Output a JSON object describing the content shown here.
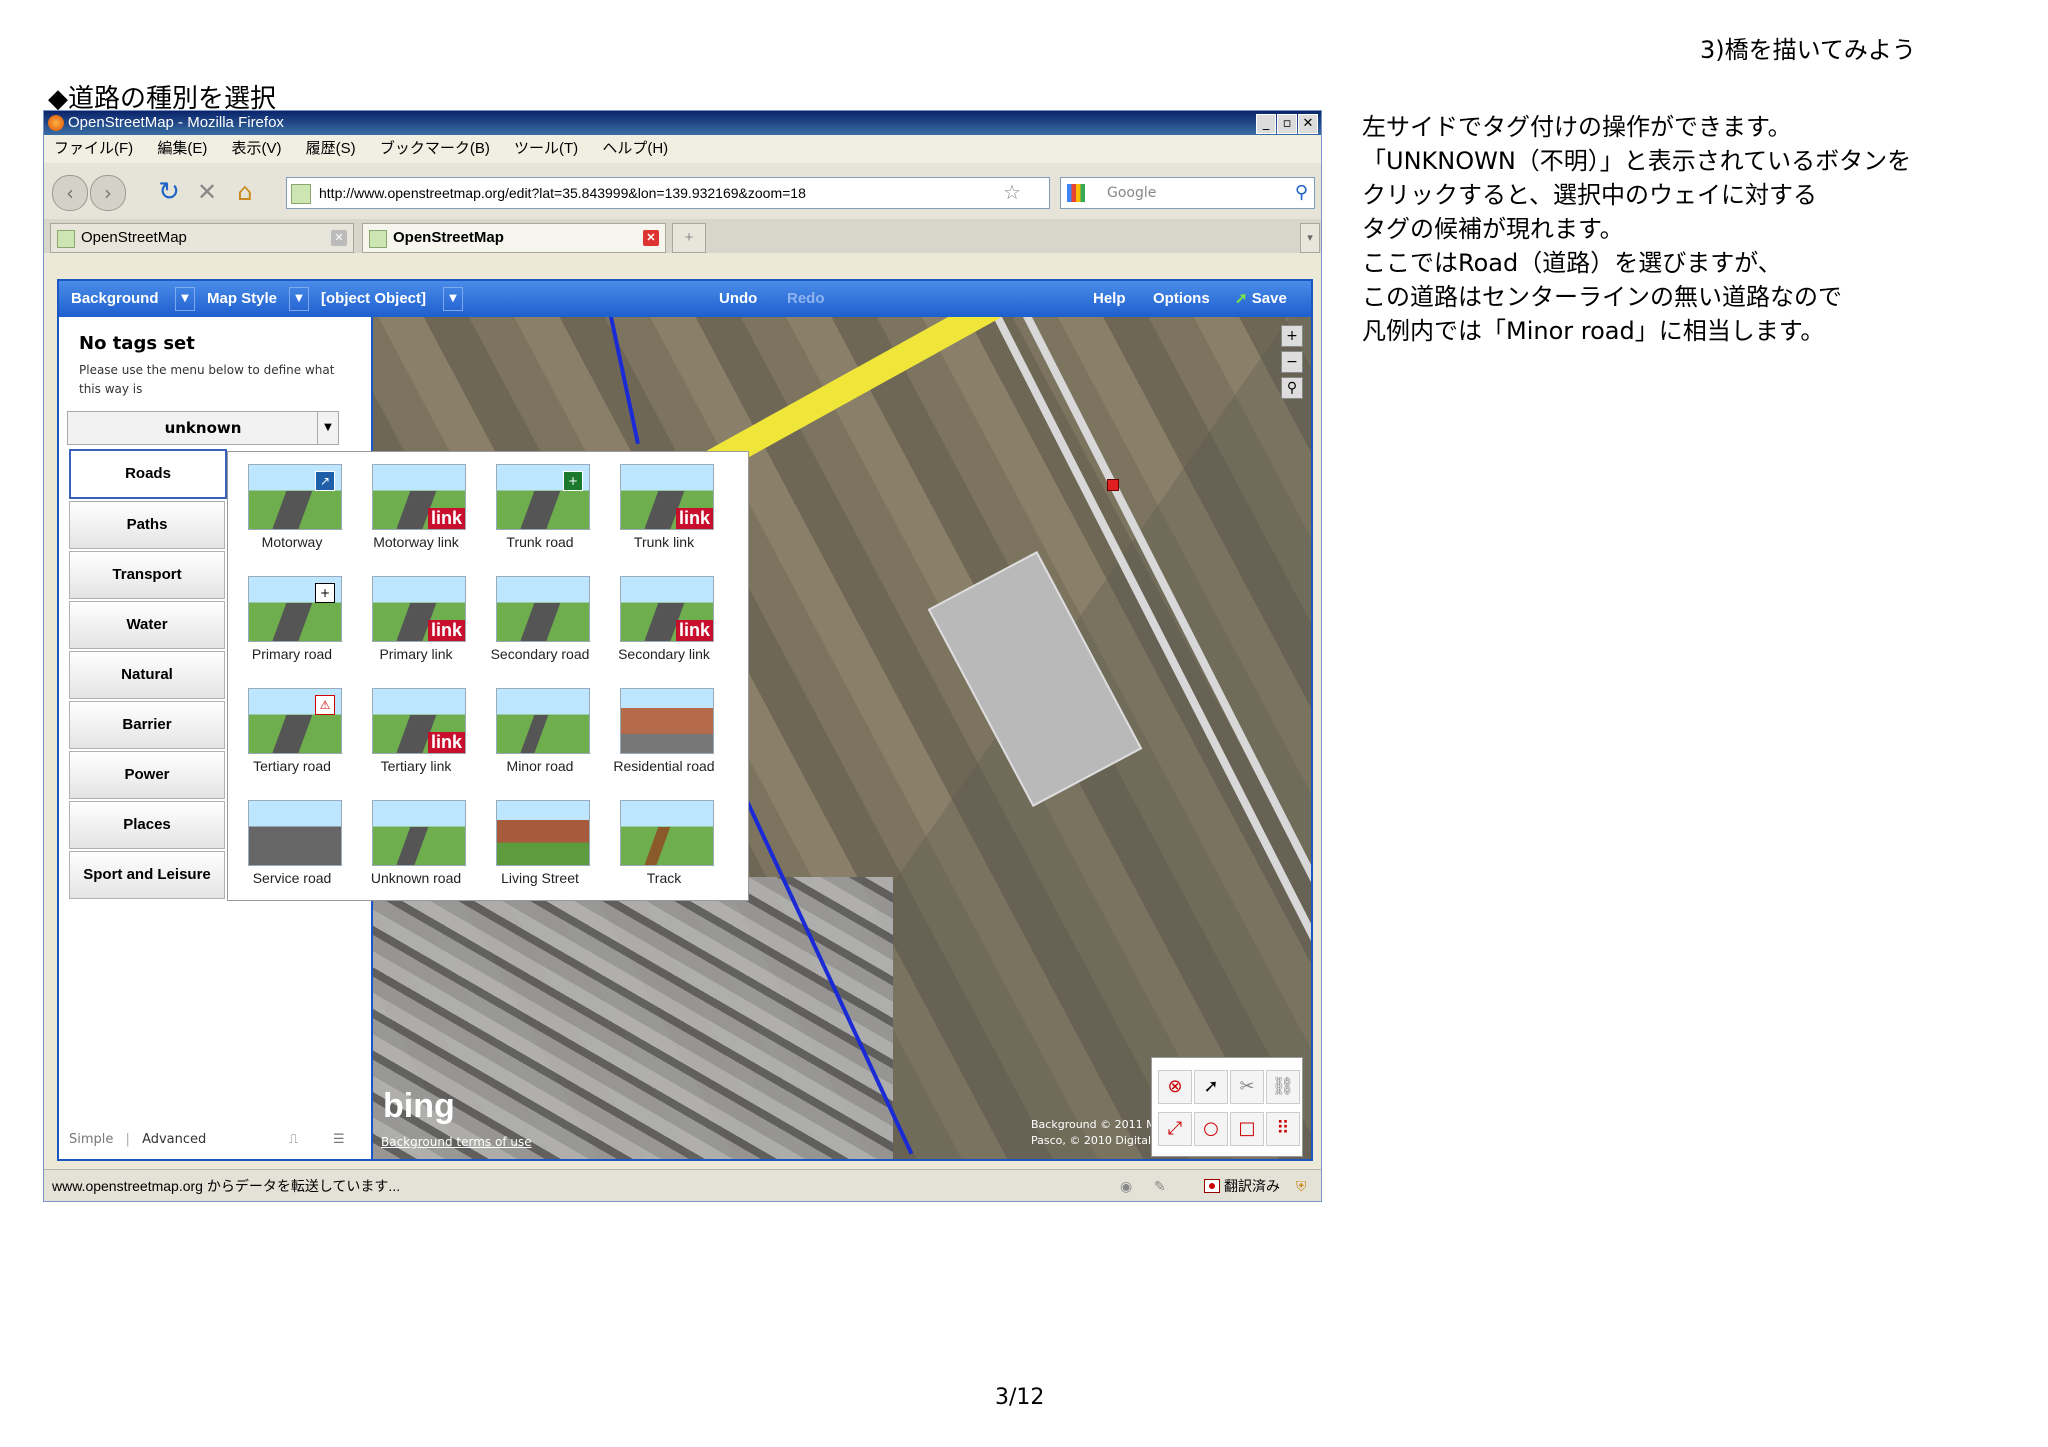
{
  "page": {
    "header": "3)橋を描いてみよう",
    "heading": "◆道路の種別を選択",
    "footer": "3/12",
    "explanation": [
      "左サイドでタグ付けの操作ができます。",
      "「UNKNOWN（不明）」と表示されているボタンを",
      "クリックすると、選択中のウェイに対する",
      "タグの候補が現れます。",
      "ここではRoad（道路）を選びますが、",
      "この道路はセンターラインの無い道路なので",
      "凡例内では「Minor road」に相当します。"
    ]
  },
  "browser": {
    "title": "OpenStreetMap - Mozilla Firefox",
    "menu": [
      "ファイル(F)",
      "編集(E)",
      "表示(V)",
      "履歴(S)",
      "ブックマーク(B)",
      "ツール(T)",
      "ヘルプ(H)"
    ],
    "url": "http://www.openstreetmap.org/edit?lat=35.843999&lon=139.932169&zoom=18",
    "search_placeholder": "Google",
    "tabs": [
      {
        "label": "OpenStreetMap",
        "active": false
      },
      {
        "label": "OpenStreetMap",
        "active": true
      }
    ],
    "status_text": "www.openstreetmap.org からデータを転送しています...",
    "status_translate": "翻訳済み"
  },
  "editor": {
    "toolbar": {
      "background": "Background",
      "map_style": "Map Style",
      "object": "[object Object]",
      "undo": "Undo",
      "redo": "Redo",
      "help": "Help",
      "options": "Options",
      "save": "Save"
    },
    "sidepanel": {
      "title": "No tags set",
      "desc": "Please use the menu below to define what this way is",
      "dropdown": "unknown",
      "categories": [
        "Roads",
        "Paths",
        "Transport",
        "Water",
        "Natural",
        "Barrier",
        "Power",
        "Places",
        "Sport and Leisure"
      ],
      "footer_simple": "Simple",
      "footer_advanced": "Advanced"
    },
    "road_types": [
      {
        "label": "Motorway",
        "badge": "sign"
      },
      {
        "label": "Motorway link",
        "badge": "link"
      },
      {
        "label": "Trunk road",
        "badge": "sign"
      },
      {
        "label": "Trunk link",
        "badge": "link"
      },
      {
        "label": "Primary road",
        "badge": "sign"
      },
      {
        "label": "Primary link",
        "badge": "link"
      },
      {
        "label": "Secondary road",
        "badge": "none"
      },
      {
        "label": "Secondary link",
        "badge": "link"
      },
      {
        "label": "Tertiary road",
        "badge": "sign"
      },
      {
        "label": "Tertiary link",
        "badge": "link"
      },
      {
        "label": "Minor road",
        "badge": "none"
      },
      {
        "label": "Residential road",
        "badge": "none"
      },
      {
        "label": "Service road",
        "badge": "none"
      },
      {
        "label": "Unknown road",
        "badge": "none"
      },
      {
        "label": "Living Street",
        "badge": "none"
      },
      {
        "label": "Track",
        "badge": "none"
      }
    ],
    "link_badge_text": "link",
    "map": {
      "bing": "bing",
      "bing_terms": "Background terms of use",
      "credits": [
        "Background © 2011 Mic",
        "Pasco, © 2010 DigitalG"
      ]
    }
  }
}
